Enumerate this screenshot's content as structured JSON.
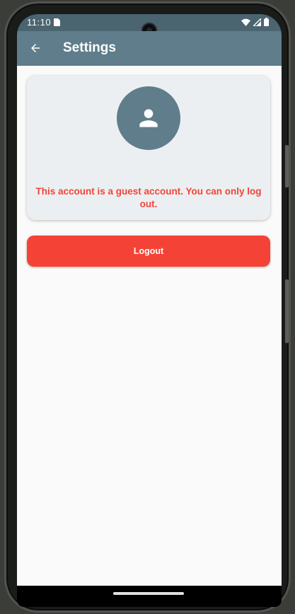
{
  "status_bar": {
    "time": "11:10",
    "icons": [
      "sim-card-icon",
      "wifi-icon",
      "signal-icon",
      "battery-icon"
    ]
  },
  "app_bar": {
    "title": "Settings",
    "back_icon": "arrow-back-icon"
  },
  "profile_card": {
    "avatar_icon": "person-icon",
    "notice": "This account is a guest account. You can only log out."
  },
  "actions": {
    "logout_label": "Logout"
  },
  "colors": {
    "app_bar": "#607d8b",
    "status_bar": "#4a6470",
    "card_background": "#eceff1",
    "accent_red": "#f44336",
    "page_background": "#fafafa"
  }
}
